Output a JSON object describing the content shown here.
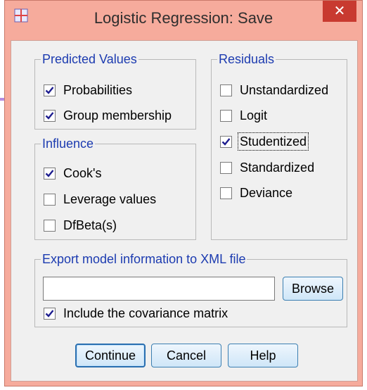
{
  "window": {
    "title": "Logistic Regression: Save",
    "close_label": "✕"
  },
  "predicted_values": {
    "legend": "Predicted Values",
    "items": [
      {
        "label": "Probabilities",
        "checked": true
      },
      {
        "label": "Group membership",
        "checked": true
      }
    ]
  },
  "influence": {
    "legend": "Influence",
    "items": [
      {
        "label": "Cook's",
        "checked": true
      },
      {
        "label": "Leverage values",
        "checked": false
      },
      {
        "label": "DfBeta(s)",
        "checked": false
      }
    ]
  },
  "residuals": {
    "legend": "Residuals",
    "items": [
      {
        "label": "Unstandardized",
        "checked": false
      },
      {
        "label": "Logit",
        "checked": false
      },
      {
        "label": "Studentized",
        "checked": true
      },
      {
        "label": "Standardized",
        "checked": false
      },
      {
        "label": "Deviance",
        "checked": false
      }
    ]
  },
  "export": {
    "legend": "Export model information to XML file",
    "file_value": "",
    "browse_label": "Browse",
    "include_cov": {
      "label": "Include the covariance matrix",
      "checked": true
    }
  },
  "buttons": {
    "continue": "Continue",
    "cancel": "Cancel",
    "help": "Help"
  },
  "annotation": {
    "arrow_color": "#b48ce0"
  }
}
